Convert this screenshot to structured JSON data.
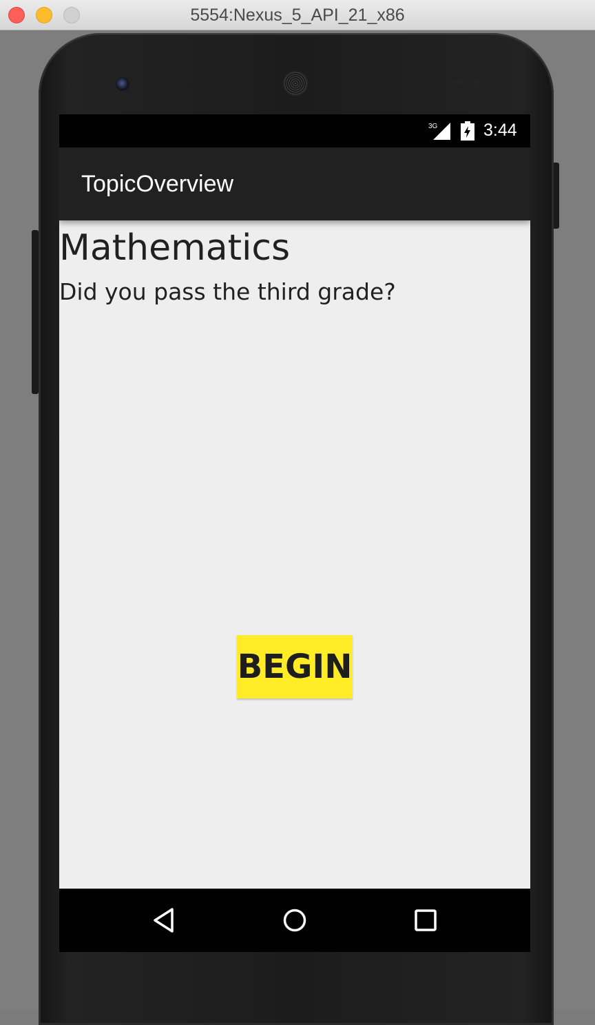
{
  "window": {
    "title": "5554:Nexus_5_API_21_x86"
  },
  "status_bar": {
    "network_label": "3G",
    "time": "3:44"
  },
  "action_bar": {
    "title": "TopicOverview"
  },
  "content": {
    "topic_title": "Mathematics",
    "topic_description": "Did you pass the third grade?",
    "begin_label": "BEGIN"
  },
  "navigation": {
    "items": [
      "back-icon",
      "home-icon",
      "recent-apps-icon"
    ]
  },
  "colors": {
    "begin_button": "#ffeb26",
    "action_bar": "#212121",
    "content_background": "#eeeeee"
  }
}
